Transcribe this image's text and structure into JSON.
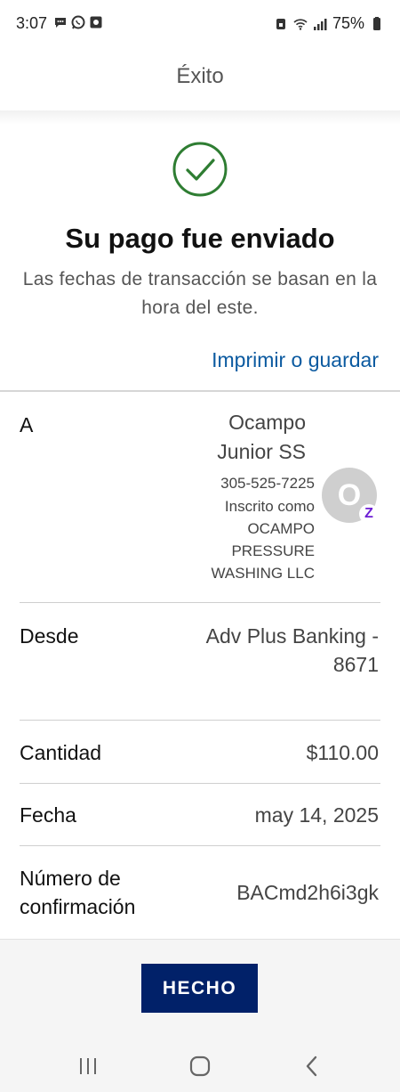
{
  "status_bar": {
    "time": "3:07",
    "battery": "75%"
  },
  "header": {
    "title": "Éxito"
  },
  "confirmation": {
    "title": "Su pago fue enviado",
    "subtitle": "Las fechas de transacción se basan en la hora del este.",
    "print_link": "Imprimir o guardar"
  },
  "details": {
    "to_label": "A",
    "recipient_name": "Ocampo Junior SS",
    "recipient_phone": "305-525-7225",
    "recipient_enrolled": "Inscrito como OCAMPO PRESSURE WASHING LLC",
    "avatar_initial": "O",
    "badge_glyph": "Z",
    "from_label": "Desde",
    "from_value": "Adv Plus Banking - 8671",
    "amount_label": "Cantidad",
    "amount_value": "$110.00",
    "date_label": "Fecha",
    "date_value": "may 14, 2025",
    "confirmation_label": "Número de confirmación",
    "confirmation_value": "BACmd2h6i3gk"
  },
  "footer": {
    "done_label": "HECHO"
  },
  "colors": {
    "brand_navy": "#012169",
    "link_blue": "#0b5aa0",
    "success_green": "#2e7d32",
    "zelle_purple": "#6d1ed4"
  }
}
